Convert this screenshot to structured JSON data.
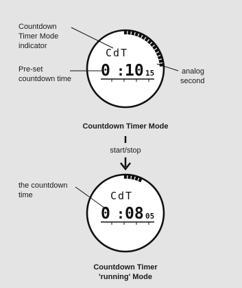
{
  "figure1": {
    "display": {
      "mode": "CdT",
      "minutes": "0",
      "colon": ":",
      "seconds": "10",
      "fraction": "15"
    },
    "labels": {
      "mode_indicator": [
        "Countdown",
        "Timer Mode",
        "indicator"
      ],
      "preset_time": [
        "Pre-set",
        "countdown time"
      ],
      "analog_second": [
        "analog",
        "second"
      ]
    },
    "caption": "Countdown Timer Mode",
    "analog_second_segments_lit": 15
  },
  "transition": {
    "label": "start/stop"
  },
  "figure2": {
    "display": {
      "mode": "CdT",
      "minutes": "0",
      "colon": ":",
      "seconds": "08",
      "fraction": "05"
    },
    "labels": {
      "countdown_time": [
        "the countdown",
        "time"
      ]
    },
    "caption": [
      "Countdown Timer",
      "'running' Mode"
    ],
    "analog_second_segments_lit": 5
  },
  "colors": {
    "background": "#e4e4e4",
    "face": "#ffffff",
    "ink": "#111111"
  }
}
